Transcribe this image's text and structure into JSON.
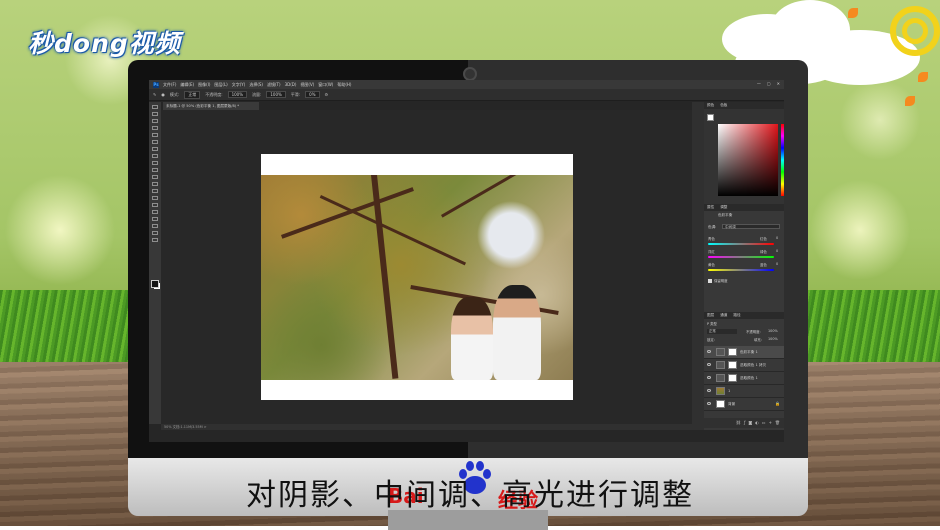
{
  "brand": {
    "logo_text": "秒dong视频"
  },
  "subtitle": "对阴影、中间调、高光进行调整",
  "watermark": {
    "left": "Bai",
    "right": "经验"
  },
  "photoshop": {
    "menu": [
      "文件(F)",
      "编辑(E)",
      "图像(I)",
      "图层(L)",
      "文字(Y)",
      "选择(S)",
      "滤镜(T)",
      "3D(D)",
      "视图(V)",
      "窗口(W)",
      "帮助(H)"
    ],
    "window_controls": [
      "—",
      "▢",
      "✕"
    ],
    "options": {
      "mode_label": "模式:",
      "mode_value": "正常",
      "opacity_label": "不透明度:",
      "opacity_value": "100%",
      "flow_label": "流量:",
      "flow_value": "100%",
      "smooth_label": "平滑:",
      "smooth_value": "0%"
    },
    "doc_tab": "未标题-1 @ 50% (色彩平衡 1, 图层蒙版/8) *",
    "status_bar": "50%   文档:1.11M/3.55M   >",
    "color_panel": {
      "tabs": [
        "颜色",
        "色板"
      ]
    },
    "properties_panel": {
      "tabs": [
        "属性",
        "调整"
      ],
      "title": "色彩平衡",
      "tone_label": "色调:",
      "tone_value": "中间调",
      "sliders": [
        {
          "left": "青色",
          "right": "红色",
          "value": "0"
        },
        {
          "left": "洋红",
          "right": "绿色",
          "value": "0"
        },
        {
          "left": "黄色",
          "right": "蓝色",
          "value": "0"
        }
      ],
      "preserve_label": "保留明度"
    },
    "layers_panel": {
      "tabs": [
        "图层",
        "通道",
        "路径"
      ],
      "kind": "P 类型",
      "blend": "正常",
      "opacity_label": "不透明度:",
      "opacity": "100%",
      "lock_label": "锁定:",
      "fill_label": "填充:",
      "fill": "100%",
      "layers": [
        {
          "name": "色彩平衡 1"
        },
        {
          "name": "选取颜色 1 拷贝"
        },
        {
          "name": "选取颜色 1"
        },
        {
          "name": "1"
        },
        {
          "name": "背景"
        }
      ]
    }
  }
}
